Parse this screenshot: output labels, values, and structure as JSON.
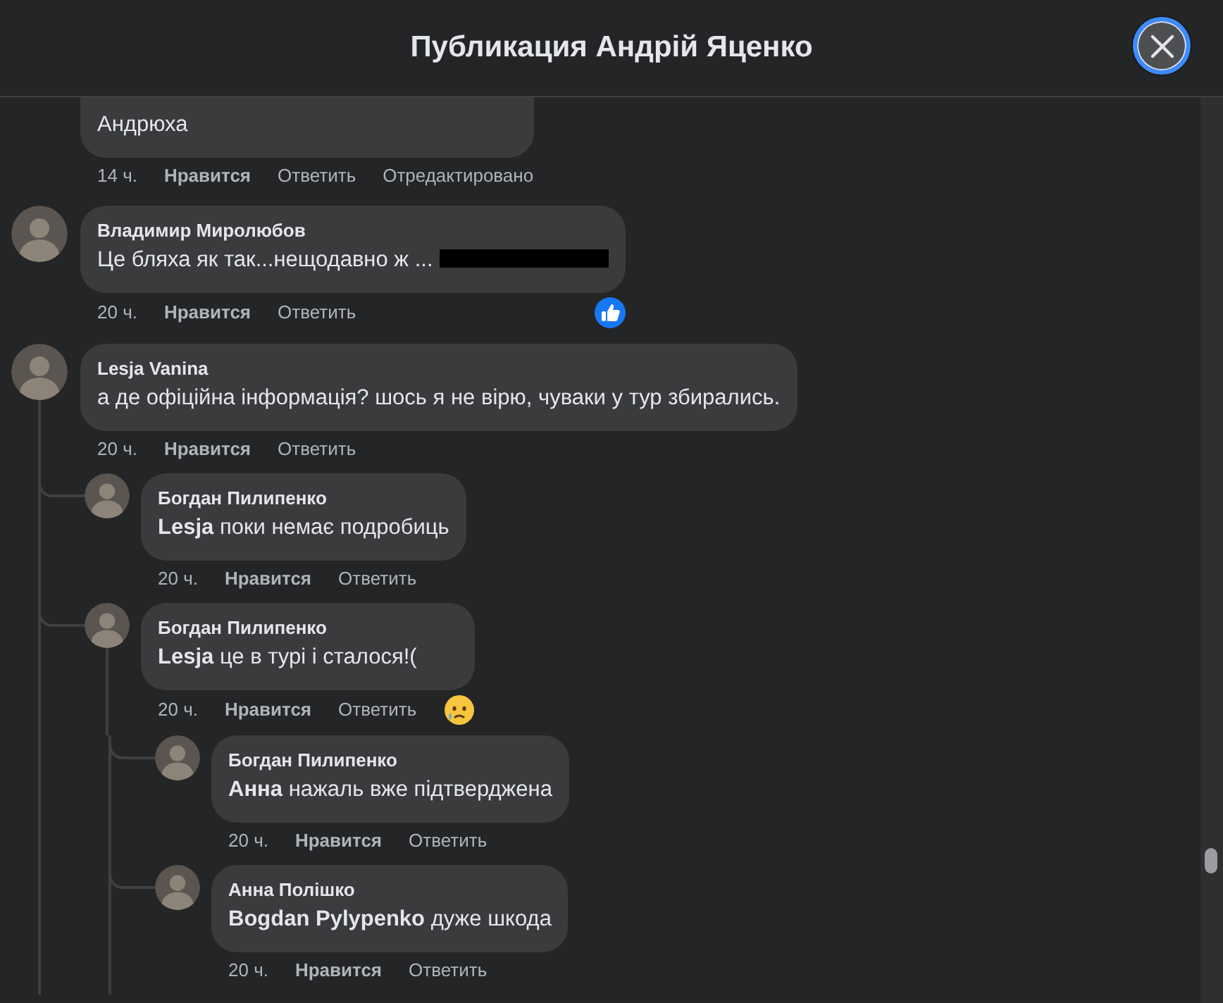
{
  "header": {
    "title": "Публикация Андрій Яценко"
  },
  "comments": [
    {
      "text": "Андрюха",
      "clipped": true,
      "time": "14 ч.",
      "like": "Нравится",
      "reply": "Ответить",
      "edited": "Отредактировано"
    },
    {
      "author": "Владимир Миролюбов",
      "text": "Це бляха як так...нещодавно ж ...",
      "redacted": true,
      "time": "20 ч.",
      "like": "Нравится",
      "reply": "Ответить",
      "reaction": {
        "kind": "like"
      }
    },
    {
      "author": "Lesja Vanina",
      "text": "а де офіційна інформація? шось я не вірю, чуваки у тур збирались.",
      "time": "20 ч.",
      "like": "Нравится",
      "reply": "Ответить",
      "children": [
        {
          "author": "Богдан Пилипенко",
          "text": "**Lesja** поки немає подробиць",
          "time": "20 ч.",
          "like": "Нравится",
          "reply": "Ответить"
        },
        {
          "author": "Богдан Пилипенко",
          "text": "**Lesja** це в турі і сталося!(",
          "time": "20 ч.",
          "like": "Нравится",
          "reply": "Ответить",
          "reaction": {
            "kind": "sad"
          },
          "children": [
            {
              "author": "Богдан Пилипенко",
              "text": "**Анна** нажаль вже підтверджена",
              "time": "20 ч.",
              "like": "Нравится",
              "reply": "Ответить"
            },
            {
              "author": "Анна Полішко",
              "text": "**Bogdan Pylypenko** дуже шкода",
              "time": "20 ч.",
              "like": "Нравится",
              "reply": "Ответить"
            }
          ]
        }
      ]
    }
  ]
}
